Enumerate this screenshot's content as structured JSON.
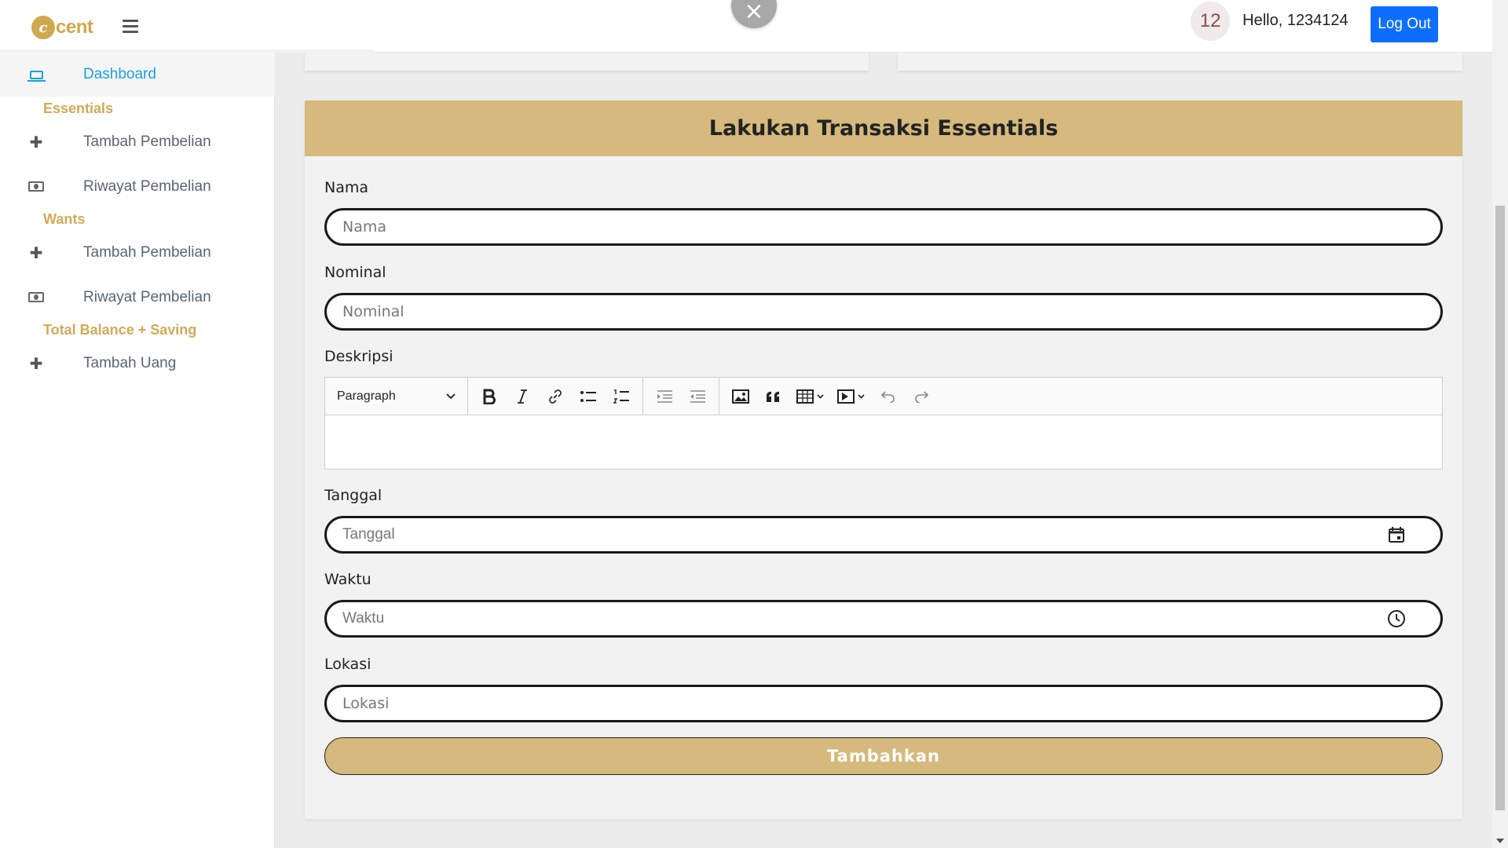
{
  "topbar": {
    "logo_mark": "c",
    "logo_text": "cent",
    "menu_icon": "hamburger-icon",
    "close_icon": "close-icon",
    "close_glyph": "×",
    "notification_count": "12",
    "greeting": "Hello, 1234124",
    "logout_label": "Log Out"
  },
  "sidebar": {
    "dashboard": {
      "label": "Dashboard",
      "icon": "laptop-icon"
    },
    "sections": [
      {
        "heading": "Essentials",
        "items": [
          {
            "label": "Tambah Pembelian",
            "icon": "plus-icon",
            "glyph": "✚"
          },
          {
            "label": "Riwayat Pembelian",
            "icon": "money-bill-icon"
          }
        ]
      },
      {
        "heading": "Wants",
        "items": [
          {
            "label": "Tambah Pembelian",
            "icon": "plus-icon",
            "glyph": "✚"
          },
          {
            "label": "Riwayat Pembelian",
            "icon": "money-bill-icon"
          }
        ]
      },
      {
        "heading": "Total Balance + Saving",
        "items": [
          {
            "label": "Tambah Uang",
            "icon": "plus-icon",
            "glyph": "✚"
          }
        ]
      }
    ]
  },
  "form": {
    "title": "Lakukan Transaksi Essentials",
    "nama": {
      "label": "Nama",
      "placeholder": "Nama",
      "value": ""
    },
    "nominal": {
      "label": "Nominal",
      "placeholder": "Nominal",
      "value": ""
    },
    "deskripsi": {
      "label": "Deskripsi",
      "paragraph_style": "Paragraph",
      "toolbar_icons": [
        "bold-icon",
        "italic-icon",
        "link-icon",
        "bulleted-list-icon",
        "numbered-list-icon",
        "increase-indent-icon",
        "decrease-indent-icon",
        "image-icon",
        "blockquote-icon",
        "table-icon",
        "media-icon",
        "undo-icon",
        "redo-icon"
      ],
      "content": ""
    },
    "tanggal": {
      "label": "Tanggal",
      "placeholder": "Tanggal",
      "value": "",
      "icon": "calendar-icon"
    },
    "waktu": {
      "label": "Waktu",
      "placeholder": "Waktu",
      "value": "",
      "icon": "clock-icon"
    },
    "lokasi": {
      "label": "Lokasi",
      "placeholder": "Lokasi",
      "value": ""
    },
    "submit_label": "Tambahkan"
  },
  "colors": {
    "accent_gold": "#d5b97d",
    "sidebar_heading": "#cfaa5a",
    "active_link": "#1e9fd8",
    "logout_blue": "#0d6efd"
  }
}
